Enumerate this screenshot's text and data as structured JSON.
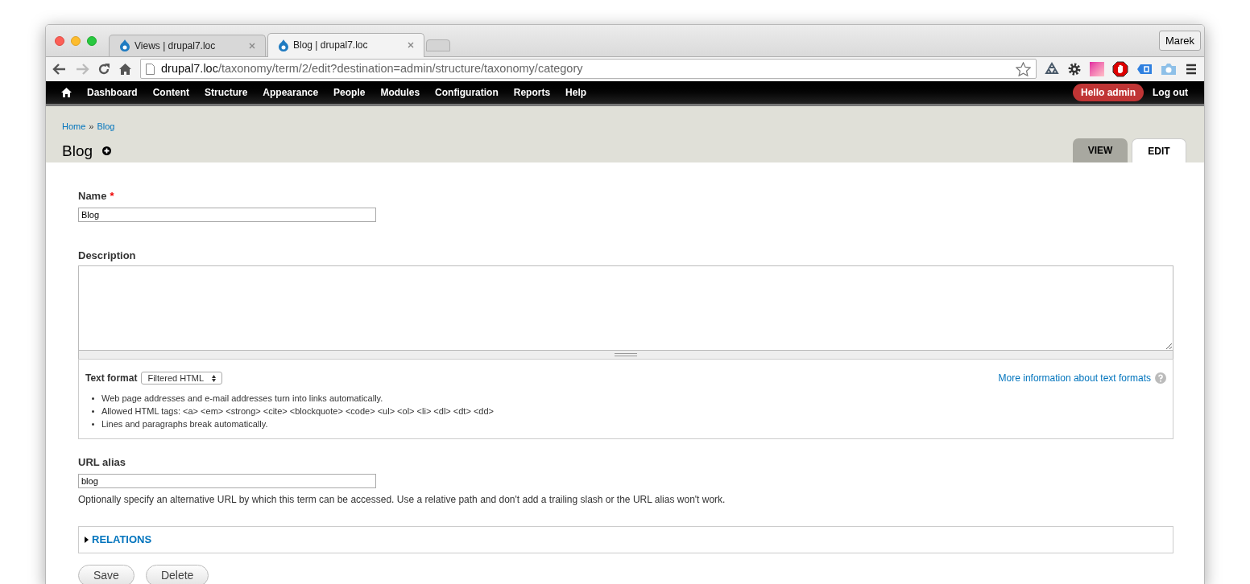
{
  "browser": {
    "tabs": [
      {
        "title": "Views | drupal7.loc",
        "selected": false
      },
      {
        "title": "Blog | drupal7.loc",
        "selected": true
      }
    ],
    "profile": "Marek",
    "url": {
      "host": "drupal7.loc",
      "path": "/taxonomy/term/2/edit?destination=admin/structure/taxonomy/category"
    }
  },
  "admin_menu": {
    "items": [
      "Dashboard",
      "Content",
      "Structure",
      "Appearance",
      "People",
      "Modules",
      "Configuration",
      "Reports",
      "Help"
    ],
    "greeting": "Hello admin",
    "logout": "Log out"
  },
  "breadcrumb": {
    "items": [
      "Home",
      "Blog"
    ],
    "separator": "»"
  },
  "page_title": "Blog",
  "tabs": [
    {
      "label": "VIEW",
      "selected": false
    },
    {
      "label": "EDIT",
      "selected": true
    }
  ],
  "form": {
    "required_mark": "*",
    "name": {
      "label": "Name",
      "required": true,
      "value": "Blog"
    },
    "description": {
      "label": "Description"
    },
    "text_format": {
      "label": "Text format",
      "select": "Filtered HTML",
      "help_link": "More information about text formats",
      "tips": [
        "Web page addresses and e-mail addresses turn into links automatically.",
        "Allowed HTML tags: <a> <em> <strong> <cite> <blockquote> <code> <ul> <ol> <li> <dl> <dt> <dd>",
        "Lines and paragraphs break automatically."
      ]
    },
    "url_alias": {
      "label": "URL alias",
      "value": "blog",
      "description": "Optionally specify an alternative URL by which this term can be accessed. Use a relative path and don't add a trailing slash or the URL alias won't work."
    },
    "relations": {
      "label": "RELATIONS",
      "expanded": false
    },
    "buttons": [
      "Save",
      "Delete"
    ]
  }
}
